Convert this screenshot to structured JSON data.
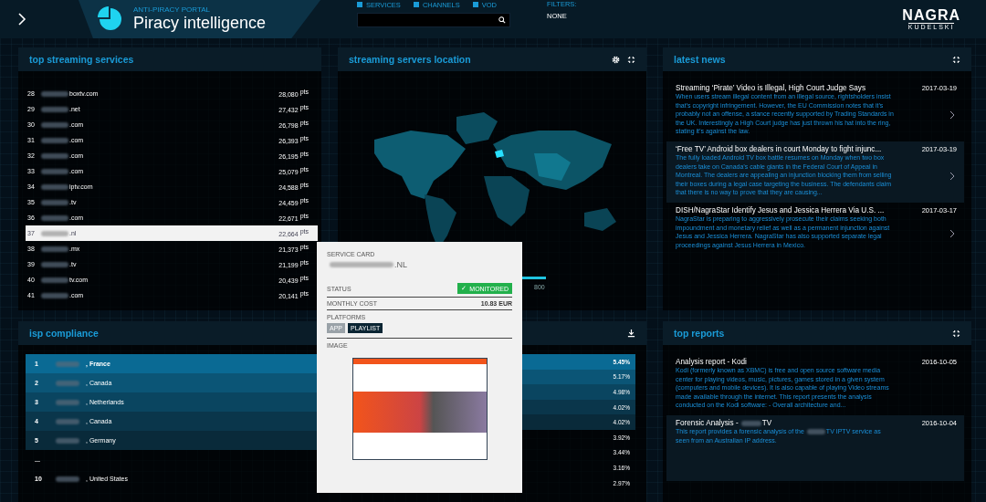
{
  "header": {
    "portal_label": "ANTI-PIRACY PORTAL",
    "title": "Piracy intelligence",
    "filters": [
      {
        "label": "SERVICES",
        "checked": true
      },
      {
        "label": "CHANNELS",
        "checked": true
      },
      {
        "label": "VOD",
        "checked": true
      }
    ],
    "filters_label": "FILTERS:",
    "filters_value": "NONE",
    "brand": "NAGRA",
    "brand_sub": "KUDELSKI"
  },
  "top_streaming": {
    "title": "top streaming services",
    "rows": [
      {
        "rank": "28",
        "domain": "boxtv.com",
        "points": "28,080",
        "unit": "pts",
        "selected": false
      },
      {
        "rank": "29",
        "domain": ".net",
        "points": "27,432",
        "unit": "pts",
        "selected": false
      },
      {
        "rank": "30",
        "domain": ".com",
        "points": "26,798",
        "unit": "pts",
        "selected": false
      },
      {
        "rank": "31",
        "domain": ".com",
        "points": "26,393",
        "unit": "pts",
        "selected": false
      },
      {
        "rank": "32",
        "domain": ".com",
        "points": "26,195",
        "unit": "pts",
        "selected": false
      },
      {
        "rank": "33",
        "domain": ".com",
        "points": "25,079",
        "unit": "pts",
        "selected": false
      },
      {
        "rank": "34",
        "domain": "iptv.com",
        "points": "24,588",
        "unit": "pts",
        "selected": false
      },
      {
        "rank": "35",
        "domain": ".tv",
        "points": "24,459",
        "unit": "pts",
        "selected": false
      },
      {
        "rank": "36",
        "domain": ".com",
        "points": "22,671",
        "unit": "pts",
        "selected": false
      },
      {
        "rank": "37",
        "domain": ".nl",
        "points": "22,664",
        "unit": "pts",
        "selected": true
      },
      {
        "rank": "38",
        "domain": ".mx",
        "points": "21,373",
        "unit": "pts",
        "selected": false
      },
      {
        "rank": "39",
        "domain": ".tv",
        "points": "21,199",
        "unit": "pts",
        "selected": false
      },
      {
        "rank": "40",
        "domain": "tv.com",
        "points": "20,439",
        "unit": "pts",
        "selected": false
      },
      {
        "rank": "41",
        "domain": ".com",
        "points": "20,141",
        "unit": "pts",
        "selected": false
      }
    ]
  },
  "servers_map": {
    "title": "streaming servers location",
    "legend_max": "800"
  },
  "latest_news": {
    "title": "latest news",
    "items": [
      {
        "title": "Streaming ‘Pirate’ Video is Illegal, High Court Judge Says",
        "date": "2017-03-19",
        "selected": false,
        "body": "When users stream illegal content from an illegal source, rightsholders insist that’s copyright infringement. However, the EU Commission notes that it’s probably not an offense, a stance recently supported by Trading Standards in the UK. Interestingly a High Court judge has just thrown his hat into the ring, stating it’s against the law."
      },
      {
        "title": "‘Free TV’ Android box dealers in court Monday to fight injunc...",
        "date": "2017-03-19",
        "selected": true,
        "body": "The fully loaded Android TV box battle resumes on Monday when two box dealers take on Canada’s cable giants in the Federal Court of Appeal in Montreal. The dealers are appealing an injunction blocking them from selling their boxes during a legal case targeting the business. The defendants claim that there is no way to prove that they are causing..."
      },
      {
        "title": "DISH/NagraStar Identify Jesus and Jessica Herrera Via U.S. ...",
        "date": "2017-03-17",
        "selected": false,
        "body": "NagraStar is preparing to aggressively prosecute their claims seeking both impoundment and monetary relief as well as a permanent injunction against Jesus and Jessica Herrera. NagraStar has also supported separate legal proceedings against Jesus Herrera in Mexico."
      }
    ]
  },
  "isp_compliance": {
    "title": "isp compliance",
    "rows": [
      {
        "kind": "row",
        "rank": "1",
        "name": ", France"
      },
      {
        "kind": "row",
        "rank": "2",
        "name": ", Canada"
      },
      {
        "kind": "row",
        "rank": "3",
        "name": ", Netherlands"
      },
      {
        "kind": "row",
        "rank": "4",
        "name": ", Canada"
      },
      {
        "kind": "row",
        "rank": "5",
        "name": ", Germany"
      },
      {
        "kind": "gap",
        "rank": "..."
      },
      {
        "kind": "row",
        "rank": "10",
        "name": ", United States"
      }
    ],
    "scores": [
      "5.45%",
      "5.17%",
      "4.98%",
      "4.02%",
      "4.02%",
      "3.92%",
      "3.44%",
      "3.16%",
      "2.97%"
    ]
  },
  "top_reports": {
    "title": "top reports",
    "items": [
      {
        "title": [
          "Analysis report - Kodi"
        ],
        "date": "2016-10-05",
        "selected": false,
        "body": [
          "Kodi (formerly known as XBMC) is free and open source software media center for playing videos, music, pictures, games stored in a given system (computers and mobile devices). It is also capable of playing Video streams made available through the internet. This report presents the analysis conducted on the Kodi software: - Overall architecture and..."
        ]
      },
      {
        "title": [
          "Forensic Analysis -",
          "TV"
        ],
        "date": "2016-10-04",
        "selected": true,
        "body": [
          "This report provides a forensic analysis of the",
          "TV IPTV service as seen from an Australian IP address."
        ]
      }
    ]
  },
  "service_card": {
    "heading": "SERVICE CARD",
    "name": ".NL",
    "status_label": "STATUS",
    "status_icon": "✓",
    "status": "MONITORED",
    "cost_label": "MONTHLY COST",
    "cost": "10.83 EUR",
    "platforms_label": "PLATFORMS",
    "platforms": [
      {
        "label": "APP",
        "selected": false
      },
      {
        "label": "PLAYLIST",
        "selected": true
      }
    ],
    "image_label": "IMAGE"
  }
}
